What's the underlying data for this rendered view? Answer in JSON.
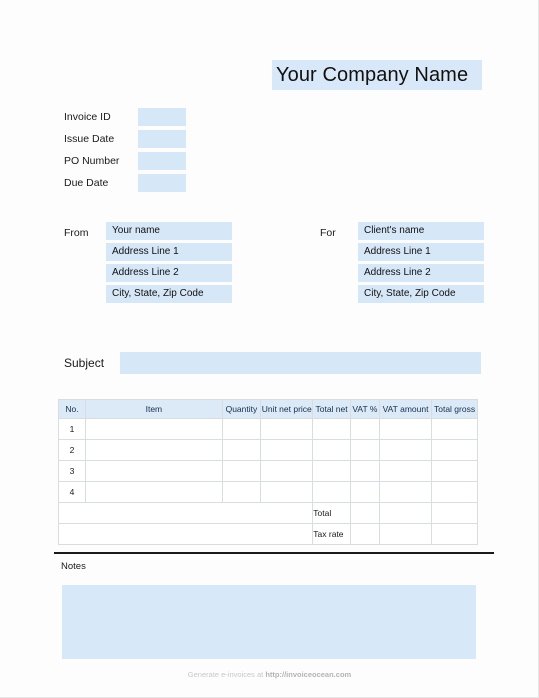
{
  "header": {
    "company_name": "Your Company Name"
  },
  "meta": {
    "fields": [
      {
        "label": "Invoice ID",
        "value": ""
      },
      {
        "label": "Issue Date",
        "value": ""
      },
      {
        "label": "PO Number",
        "value": ""
      },
      {
        "label": "Due Date",
        "value": ""
      }
    ]
  },
  "parties": {
    "from": {
      "label": "From",
      "lines": [
        "Your name",
        "Address Line 1",
        "Address Line 2",
        "City, State, Zip Code"
      ]
    },
    "for": {
      "label": "For",
      "lines": [
        "Client's name",
        "Address Line 1",
        "Address Line 2",
        "City, State, Zip Code"
      ]
    }
  },
  "subject": {
    "label": "Subject",
    "value": ""
  },
  "items_table": {
    "columns": [
      "No.",
      "Item",
      "Quantity",
      "Unit net price",
      "Total net",
      "VAT %",
      "VAT amount",
      "Total gross"
    ],
    "rows": [
      {
        "no": "1",
        "item": "",
        "quantity": "",
        "unit_net_price": "",
        "total_net": "",
        "vat_percent": "",
        "vat_amount": "",
        "total_gross": ""
      },
      {
        "no": "2",
        "item": "",
        "quantity": "",
        "unit_net_price": "",
        "total_net": "",
        "vat_percent": "",
        "vat_amount": "",
        "total_gross": ""
      },
      {
        "no": "3",
        "item": "",
        "quantity": "",
        "unit_net_price": "",
        "total_net": "",
        "vat_percent": "",
        "vat_amount": "",
        "total_gross": ""
      },
      {
        "no": "4",
        "item": "",
        "quantity": "",
        "unit_net_price": "",
        "total_net": "",
        "vat_percent": "",
        "vat_amount": "",
        "total_gross": ""
      }
    ],
    "summary": [
      {
        "label": "Total",
        "vat_percent": "",
        "vat_amount": "",
        "total_gross": ""
      },
      {
        "label": "Tax rate",
        "vat_percent": "",
        "vat_amount": "",
        "total_gross": ""
      }
    ]
  },
  "notes": {
    "label": "Notes",
    "value": ""
  },
  "footer": {
    "text": "Generate e-invoices at ",
    "url": "http://invoiceocean.com"
  },
  "colors": {
    "field_blue": "#d6e7f7",
    "header_blue": "#dce9f7",
    "page_white": "#fdfdfd",
    "rule_black": "#1a1a1a",
    "border_gray": "#d8dde2"
  }
}
